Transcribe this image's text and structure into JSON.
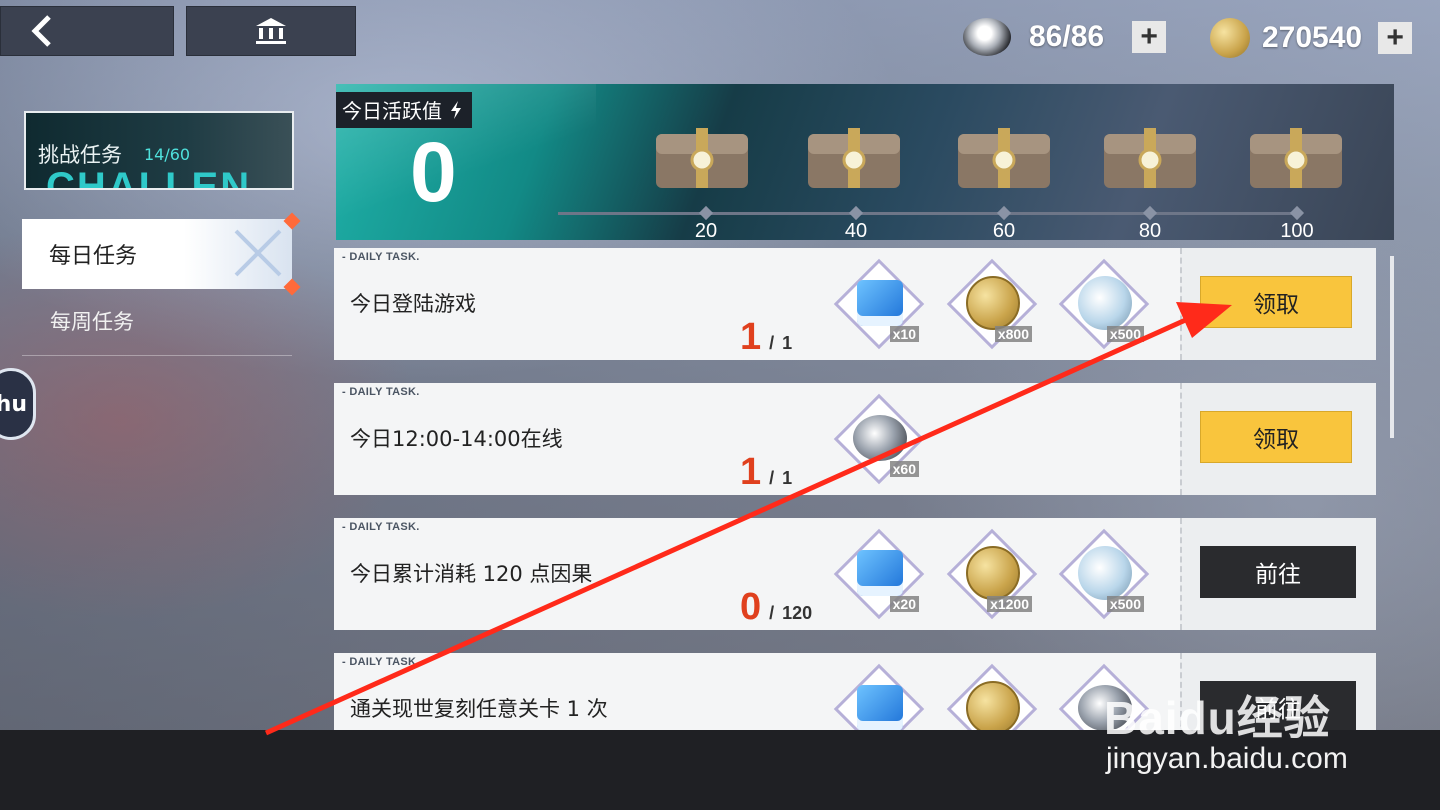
{
  "header": {
    "back_icon": "chevron-left-icon",
    "home_icon": "bank-icon",
    "stamina": "86/86",
    "coins": "270540",
    "plus": "+"
  },
  "sidebar": {
    "challenge_label": "挑战任务",
    "challenge_count": "14/60",
    "challenge_bg_text": "CHALLEN",
    "items": [
      {
        "label": "每日任务"
      },
      {
        "label": "每周任务"
      }
    ],
    "float_label": "hu"
  },
  "activity": {
    "title": "今日活跃值",
    "score": "0",
    "milestones": [
      "20",
      "40",
      "60",
      "80",
      "100"
    ]
  },
  "tasks": [
    {
      "tag": "- DAILY TASK.",
      "name": "今日登陆游戏",
      "current": "1",
      "sep": "/",
      "total": "1",
      "rewards": [
        {
          "icon": "cube-icon",
          "qty": "x10"
        },
        {
          "icon": "coin-icon",
          "qty": "x800"
        },
        {
          "icon": "crystal-icon",
          "qty": "x500"
        }
      ],
      "action": "领取"
    },
    {
      "tag": "- DAILY TASK.",
      "name": "今日12:00-14:00在线",
      "current": "1",
      "sep": "/",
      "total": "1",
      "rewards": [
        {
          "icon": "stamina-icon",
          "qty": "x60"
        }
      ],
      "action": "领取"
    },
    {
      "tag": "- DAILY TASK.",
      "name": "今日累计消耗 120 点因果",
      "current": "0",
      "sep": "/",
      "total": "120",
      "rewards": [
        {
          "icon": "cube-icon",
          "qty": "x20"
        },
        {
          "icon": "coin-icon",
          "qty": "x1200"
        },
        {
          "icon": "crystal-icon",
          "qty": "x500"
        }
      ],
      "action": "前往"
    },
    {
      "tag": "- DAILY TASK.",
      "name": "通关现世复刻任意关卡 1 次",
      "action": "前往"
    }
  ],
  "watermark": {
    "brand": "Baidu经验",
    "url": "jingyan.baidu.com"
  },
  "colors": {
    "claim": "#f9c53d",
    "go": "#2a2b2e",
    "progress": "#e0401e",
    "arrow": "#ff2a1a"
  }
}
